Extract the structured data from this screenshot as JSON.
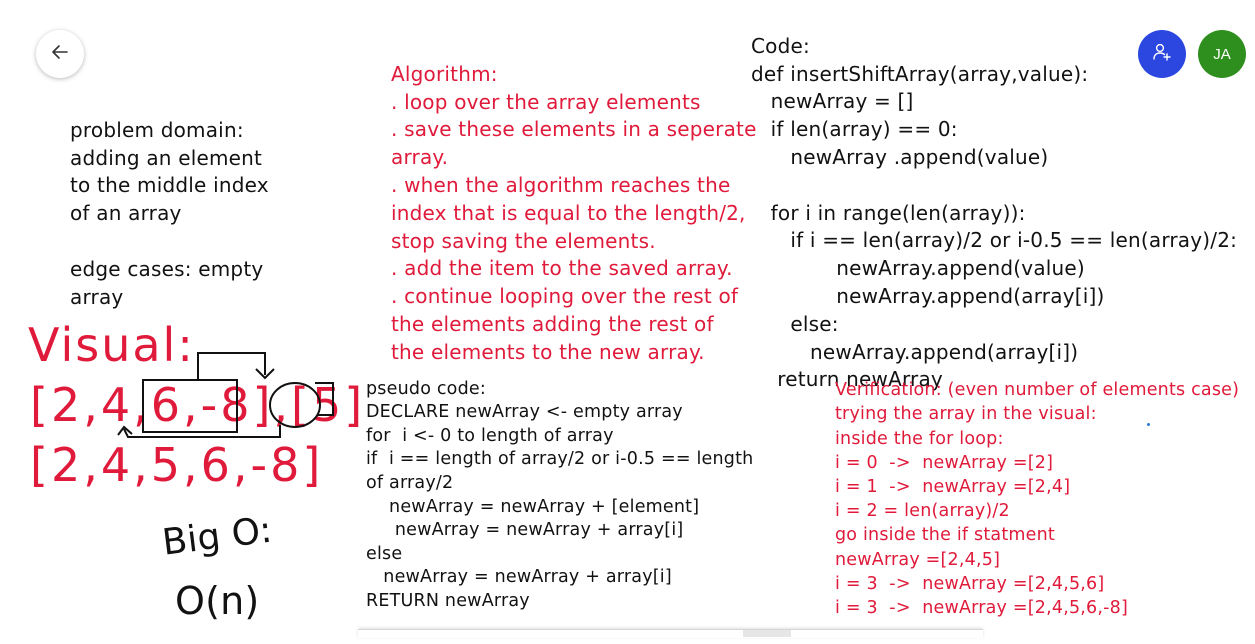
{
  "nav": {
    "back_icon": "arrow-left-icon"
  },
  "header": {
    "share_icon": "add-person-icon",
    "avatar_initials": "JA",
    "colors": {
      "share": "#2b47e0",
      "avatar": "#2f8f1e"
    }
  },
  "problem": {
    "lines": [
      "problem domain:",
      "adding an element",
      "to the middle index",
      "of an array",
      "",
      "edge cases: empty",
      "array"
    ]
  },
  "visual": {
    "title": "Visual:",
    "row1": "[2,4,6,-8],[5]",
    "row2": "[2,4,5,6,-8]"
  },
  "bigo": {
    "title": "Big O:",
    "value": "O(n)"
  },
  "algorithm": {
    "lines": [
      "Algorithm:",
      ". loop over the array elements",
      ". save these elements in a seperate",
      "array.",
      ". when the algorithm reaches the",
      "index that is equal to the length/2,",
      "stop saving the elements.",
      ". add the item to the saved array.",
      ". continue looping over the rest of",
      "the elements adding the rest of",
      "the elements to the new array."
    ]
  },
  "pseudo": {
    "lines": [
      "pseudo code:",
      "DECLARE newArray <- empty array",
      "for  i <- 0 to length of array",
      "if  i == length of array/2 or i-0.5 == length",
      "of array/2",
      "    newArray = newArray + [element]",
      "     newArray = newArray + array[i]",
      "else",
      "   newArray = newArray + array[i]",
      "RETURN newArray"
    ]
  },
  "code": {
    "lines": [
      "Code:",
      "def insertShiftArray(array,value):",
      "   newArray = []",
      "   if len(array) == 0:",
      "      newArray .append(value)",
      "",
      "   for i in range(len(array)):",
      "      if i == len(array)/2 or i-0.5 == len(array)/2:",
      "             newArray.append(value)",
      "             newArray.append(array[i])",
      "      else:",
      "         newArray.append(array[i])",
      "    return newArray"
    ]
  },
  "verification": {
    "lines": [
      "Verification: (even number of elements case)",
      "trying the array in the visual:",
      "inside the for loop:",
      "i = 0  ->  newArray =[2]",
      "i = 1  ->  newArray =[2,4]",
      "i = 2 = len(array)/2",
      "go inside the if statment",
      "newArray =[2,4,5]",
      "i = 3  ->  newArray =[2,4,5,6]",
      "i = 3  ->  newArray =[2,4,5,6,-8]"
    ]
  }
}
